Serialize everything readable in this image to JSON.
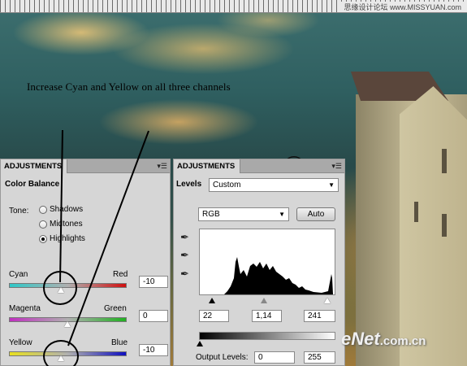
{
  "ruler": {
    "site_label": "思缘设计论坛 www.MISSYUAN.com"
  },
  "instruction": "Increase Cyan and Yellow on all three channels",
  "left_panel": {
    "tab": "ADJUSTMENTS",
    "title": "Color Balance",
    "tone_label": "Tone:",
    "tones": [
      "Shadows",
      "Midtones",
      "Highlights"
    ],
    "selected_tone": "Highlights",
    "sliders": [
      {
        "left": "Cyan",
        "right": "Red",
        "value": "-10",
        "position_fraction": 0.45
      },
      {
        "left": "Magenta",
        "right": "Green",
        "value": "0",
        "position_fraction": 0.5
      },
      {
        "left": "Yellow",
        "right": "Blue",
        "value": "-10",
        "position_fraction": 0.45
      }
    ]
  },
  "right_panel": {
    "tab": "ADJUSTMENTS",
    "title": "Levels",
    "preset": "Custom",
    "channel": "RGB",
    "auto_label": "Auto",
    "input_levels": [
      "22",
      "1,14",
      "241"
    ],
    "output_label": "Output Levels:",
    "output_levels": [
      "0",
      "255"
    ]
  },
  "watermark": {
    "brand": "eNet",
    "domain": ".com.cn"
  },
  "colors": {
    "panel_bg": "#d6d6d6",
    "cyan_red_track": [
      "#2ec8c8",
      "#d01010"
    ],
    "magenta_green_track": [
      "#c030c0",
      "#20b020"
    ],
    "yellow_blue_track": [
      "#e8e020",
      "#1010c0"
    ]
  }
}
